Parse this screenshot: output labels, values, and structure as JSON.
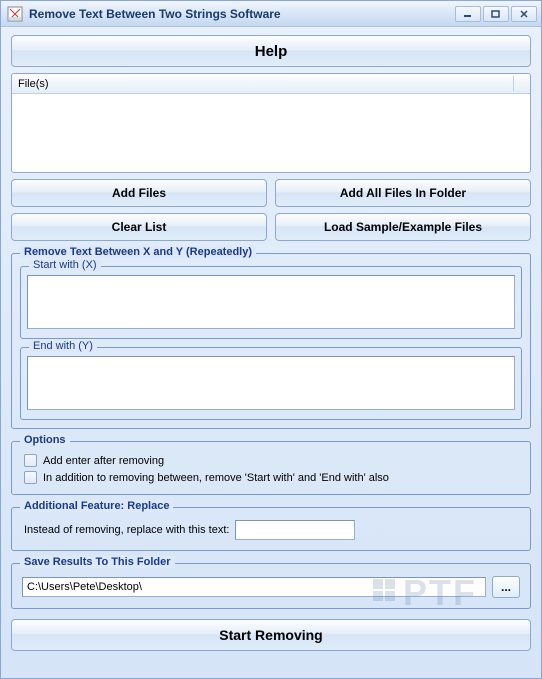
{
  "window": {
    "title": "Remove Text Between Two Strings Software"
  },
  "buttons": {
    "help": "Help",
    "add_files": "Add Files",
    "add_all_files": "Add All Files In Folder",
    "clear_list": "Clear List",
    "load_sample": "Load Sample/Example Files",
    "browse": "...",
    "start": "Start Removing"
  },
  "files": {
    "header": "File(s)"
  },
  "remove_group": {
    "title": "Remove Text Between X and Y (Repeatedly)",
    "start_with_label": "Start with (X)",
    "start_with_value": "",
    "end_with_label": "End with (Y)",
    "end_with_value": ""
  },
  "options": {
    "title": "Options",
    "add_enter": "Add enter after removing",
    "remove_delims": "In addition to removing between, remove 'Start with' and 'End with' also"
  },
  "replace": {
    "title": "Additional Feature: Replace",
    "label": "Instead of removing, replace with this text:",
    "value": ""
  },
  "save": {
    "title": "Save Results To This Folder",
    "path": "C:\\Users\\Pete\\Desktop\\"
  }
}
